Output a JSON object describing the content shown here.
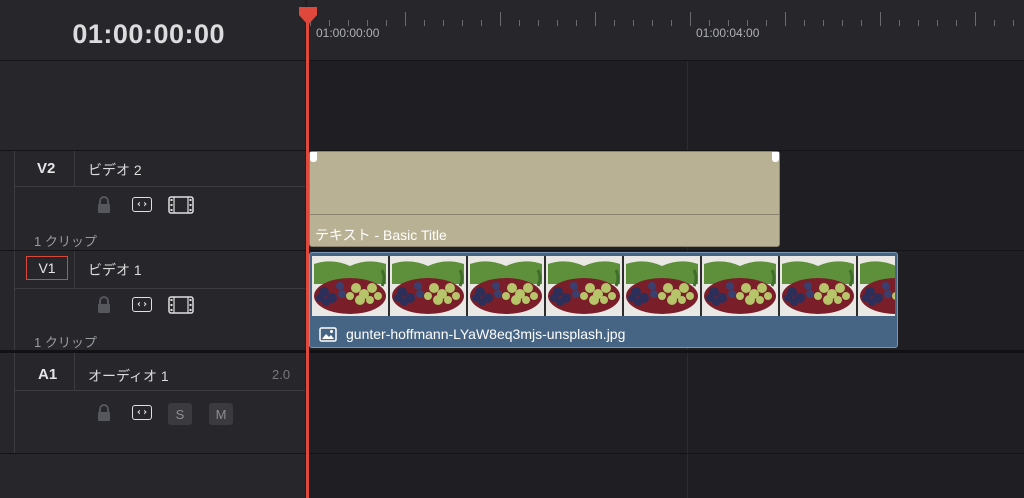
{
  "timecode": "01:00:00:00",
  "ruler": {
    "marks": [
      "01:00:00:00",
      "01:00:04:00"
    ]
  },
  "tracks": [
    {
      "id": "V2",
      "name": "ビデオ 2",
      "clip_count": "1 クリップ"
    },
    {
      "id": "V1",
      "name": "ビデオ 1",
      "clip_count": "1 クリップ"
    },
    {
      "id": "A1",
      "name": "オーディオ 1",
      "channels": "2.0",
      "solo": "S",
      "mute": "M"
    }
  ],
  "clips": {
    "title_clip": {
      "label": "テキスト - Basic Title",
      "color": "#b9b193"
    },
    "video_clip": {
      "label": "gunter-hoffmann-LYaW8eq3mjs-unsplash.jpg",
      "color": "#466584"
    }
  },
  "playhead_color": "#e0483c",
  "icons": {
    "lock": "lock-icon",
    "auto_select": "auto-select-icon",
    "video_toggle": "film-icon",
    "clip_image": "image-icon"
  }
}
